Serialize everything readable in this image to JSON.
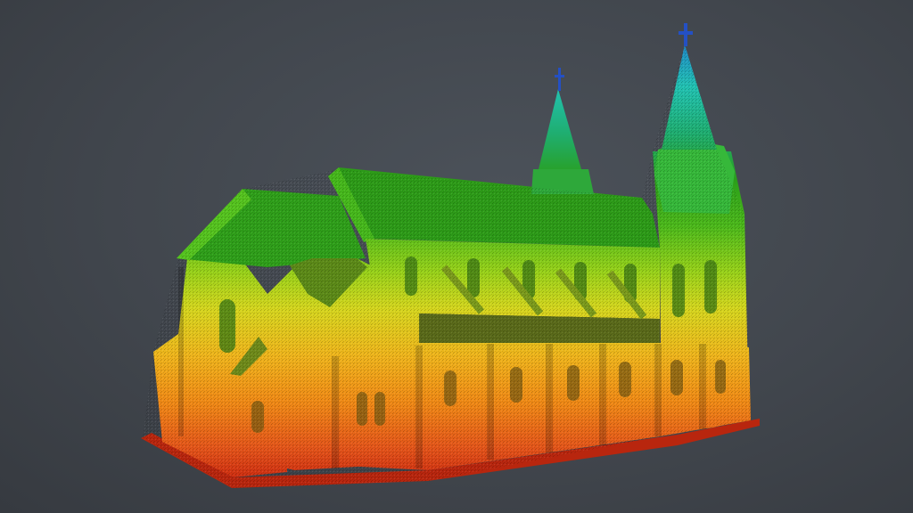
{
  "viewer": {
    "background_color": "#40454c",
    "colormap": "elevation",
    "colormap_stops": [
      "#c9240f",
      "#f07a12",
      "#f2b51a",
      "#d8d81c",
      "#7fd11a",
      "#2fb21a",
      "#1fae7c",
      "#21b6c9",
      "#2a5fd0"
    ],
    "subject_icon": "church-point-cloud-icon"
  }
}
